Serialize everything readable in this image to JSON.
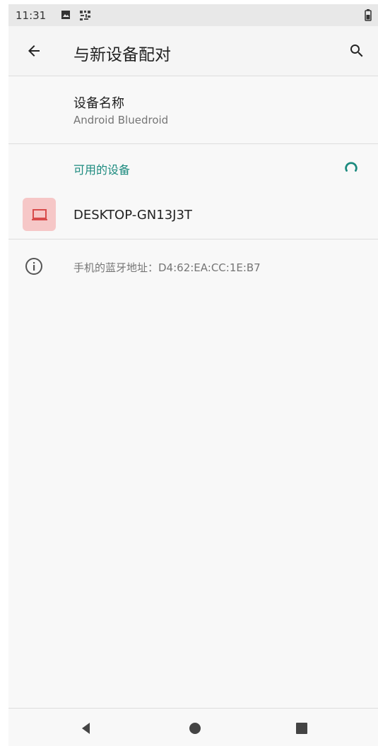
{
  "status_bar": {
    "time": "11:31",
    "icons": [
      "photo-icon",
      "notification-icon",
      "battery-icon"
    ]
  },
  "app_bar": {
    "back_icon": "arrow-left-icon",
    "title": "与新设备配对",
    "search_icon": "search-icon"
  },
  "device_name": {
    "title": "设备名称",
    "value": "Android Bluedroid"
  },
  "available_devices": {
    "header": "可用的设备",
    "spinner_icon": "loading-spinner-icon",
    "items": [
      {
        "label": "DESKTOP-GN13J3T",
        "icon": "laptop-icon"
      }
    ]
  },
  "bluetooth_address": {
    "icon": "info-icon",
    "label": "手机的蓝牙地址：D4:62:EA:CC:1E:B7"
  },
  "navigation": {
    "back": "back-icon",
    "home": "home-icon",
    "recent": "recent-apps-icon"
  },
  "colors": {
    "accent": "#1b8a7e",
    "device_icon_bg": "#f6c7c7",
    "device_icon": "#d84b4b",
    "status_bar": "#e8e8e8",
    "background": "#f8f8f8"
  }
}
